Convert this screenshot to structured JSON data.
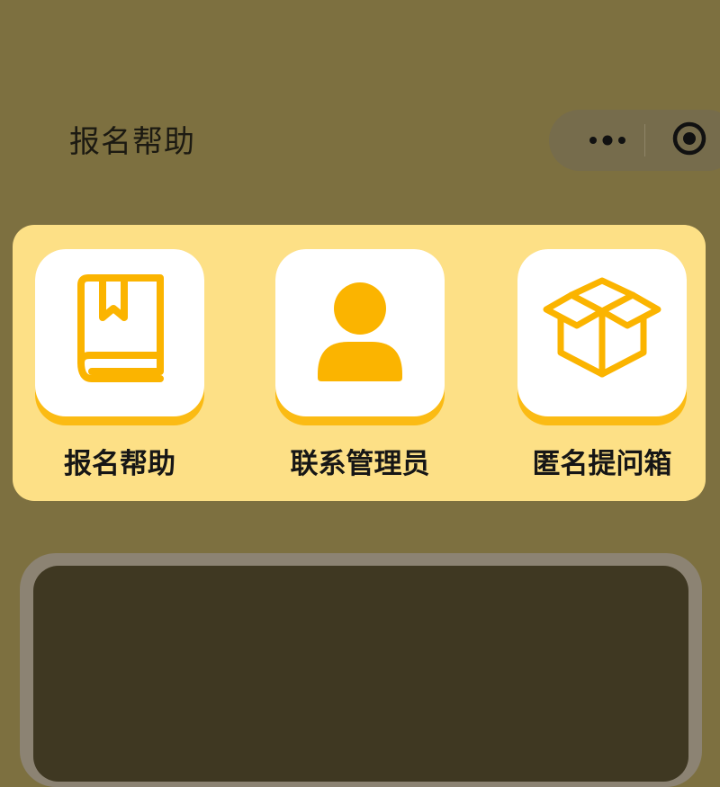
{
  "header": {
    "title": "报名帮助"
  },
  "capsule": {
    "more_icon": "more-dots-icon",
    "close_icon": "target-close-icon"
  },
  "menu": {
    "items": [
      {
        "label": "报名帮助",
        "icon": "book-icon"
      },
      {
        "label": "联系管理员",
        "icon": "user-icon"
      },
      {
        "label": "匿名提问箱",
        "icon": "open-box-icon"
      }
    ]
  },
  "colors": {
    "background": "#7d7040",
    "panel": "#fde086",
    "accent": "#fbb400",
    "tile_face": "#ffffff",
    "bottom_card": "#3f3822"
  }
}
